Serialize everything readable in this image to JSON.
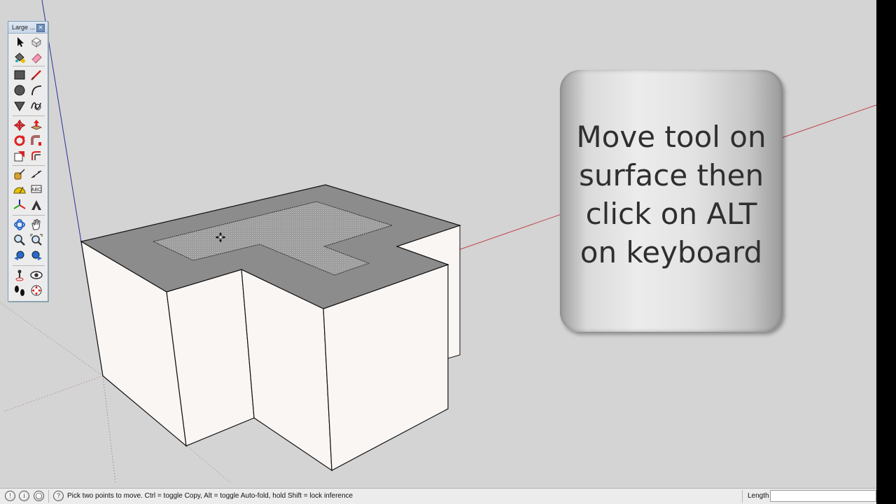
{
  "palette": {
    "title": "Large ...",
    "close_glyph": "✕",
    "tools": [
      {
        "name": "select-tool-icon"
      },
      {
        "name": "make-component-tool-icon"
      },
      {
        "name": "paint-bucket-tool-icon"
      },
      {
        "name": "eraser-tool-icon"
      },
      {
        "name": "rectangle-tool-icon"
      },
      {
        "name": "line-tool-icon"
      },
      {
        "name": "circle-tool-icon"
      },
      {
        "name": "arc-tool-icon"
      },
      {
        "name": "polygon-tool-icon"
      },
      {
        "name": "freehand-tool-icon"
      },
      {
        "name": "move-tool-icon"
      },
      {
        "name": "push-pull-tool-icon"
      },
      {
        "name": "rotate-tool-icon"
      },
      {
        "name": "follow-me-tool-icon"
      },
      {
        "name": "scale-tool-icon"
      },
      {
        "name": "offset-tool-icon"
      },
      {
        "name": "tape-measure-tool-icon"
      },
      {
        "name": "dimension-tool-icon"
      },
      {
        "name": "protractor-tool-icon"
      },
      {
        "name": "text-tool-icon"
      },
      {
        "name": "axes-tool-icon"
      },
      {
        "name": "3d-text-tool-icon"
      },
      {
        "name": "orbit-tool-icon"
      },
      {
        "name": "pan-tool-icon"
      },
      {
        "name": "zoom-tool-icon"
      },
      {
        "name": "zoom-extents-tool-icon"
      },
      {
        "name": "previous-view-tool-icon"
      },
      {
        "name": "next-view-tool-icon"
      },
      {
        "name": "position-camera-tool-icon"
      },
      {
        "name": "look-around-tool-icon"
      },
      {
        "name": "walk-tool-icon"
      },
      {
        "name": "section-plane-tool-icon"
      }
    ]
  },
  "callout": {
    "text": "Move tool on\nsurface then\nclick on ALT\non keyboard"
  },
  "statusbar": {
    "icons": [
      {
        "name": "geo-location-icon",
        "glyph": "!"
      },
      {
        "name": "credits-icon",
        "glyph": "i"
      },
      {
        "name": "account-icon",
        "glyph": "◯"
      },
      {
        "name": "instructor-help-icon",
        "glyph": "?"
      }
    ],
    "hint": "Pick two points to move.  Ctrl = toggle Copy, Alt = toggle Auto-fold, hold Shift = lock inference",
    "measurements_label": "Length",
    "measurements_value": ""
  },
  "colors": {
    "background": "#d4d4d4",
    "face_front": "#faf6f4",
    "face_top": "#8c8c8c",
    "axis_red": "#c0474f",
    "axis_blue": "#2b2f9c",
    "axis_green": "#3c8c3c"
  }
}
